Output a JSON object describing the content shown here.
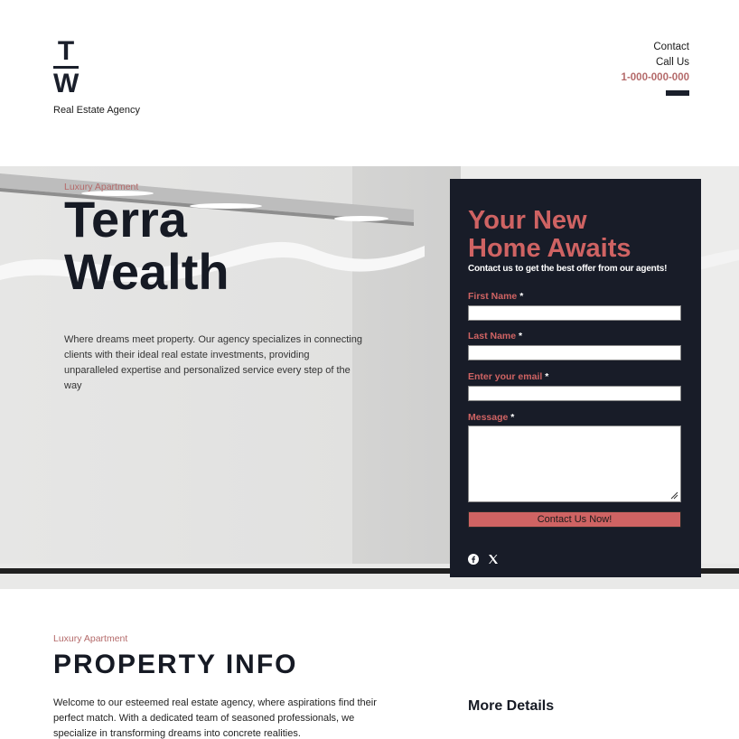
{
  "header": {
    "logo_top": "T",
    "logo_bottom": "W",
    "tagline": "Real Estate Agency",
    "contact_label": "Contact",
    "call_label": "Call Us",
    "phone": "1-000-000-000",
    "menu_icon": "hamburger-bar-icon"
  },
  "hero": {
    "eyebrow": "Luxury Apartment",
    "title_line1": "Terra",
    "title_line2": "Wealth",
    "description": "Where dreams meet property. Our agency specializes in connecting clients with their ideal real estate investments, providing unparalleled expertise and personalized service every step of the way"
  },
  "form": {
    "title_line1": "Your New",
    "title_line2": "Home Awaits",
    "subtitle": "Contact us to get the best offer from our agents!",
    "first_name_label": "First Name",
    "last_name_label": "Last Name",
    "email_label": "Enter your email",
    "message_label": "Message",
    "required_mark": "*",
    "first_name_value": "",
    "last_name_value": "",
    "email_value": "",
    "message_value": "",
    "submit_label": "Contact Us Now!",
    "social": [
      "facebook-icon",
      "x-twitter-icon"
    ]
  },
  "property": {
    "eyebrow": "Luxury Apartment",
    "title": "PROPERTY INFO",
    "text": "Welcome to our esteemed real estate agency, where aspirations find their perfect match. With a dedicated team of seasoned professionals, we specialize in transforming dreams into concrete realities.",
    "more_details": "More Details"
  },
  "colors": {
    "accent": "#cf6363",
    "accent_muted": "#b46a6a",
    "panel": "#181c28",
    "heading": "#161a24"
  }
}
